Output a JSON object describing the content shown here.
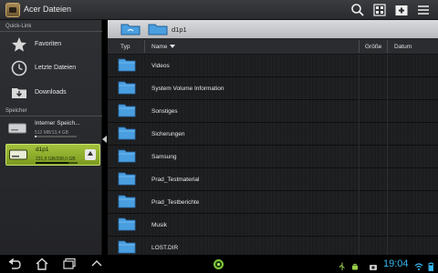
{
  "app": {
    "title": "Acer Dateien"
  },
  "toolbar": {
    "icons": [
      "search-icon",
      "grid-view-icon",
      "new-folder-icon",
      "menu-icon"
    ]
  },
  "sidebar": {
    "quick_link_label": "Quick-Link",
    "quick_links": [
      {
        "label": "Favoriten",
        "icon": "star-icon"
      },
      {
        "label": "Letzte Dateien",
        "icon": "clock-icon"
      },
      {
        "label": "Downloads",
        "icon": "downloads-folder-icon"
      }
    ],
    "storage_label": "Speicher",
    "storage": [
      {
        "name": "Interner Speich...",
        "size": "512 MB/13,4 GB",
        "used_fraction": 0.04,
        "active": false
      },
      {
        "name": "d1p1",
        "size": "231,5 GB/298,0 GB",
        "used_fraction": 0.78,
        "active": true
      }
    ]
  },
  "path": {
    "crumbs": [
      {
        "label": ""
      },
      {
        "label": "d1p1"
      }
    ]
  },
  "table": {
    "columns": {
      "type": "Typ",
      "name": "Name",
      "size": "Größe",
      "date": "Datum"
    },
    "sort": "name-descending",
    "rows": [
      {
        "name": "Videos"
      },
      {
        "name": "System Volume Information"
      },
      {
        "name": "Sonstiges"
      },
      {
        "name": "Sicherungen"
      },
      {
        "name": "Samsung"
      },
      {
        "name": "Prad_Testmaterial"
      },
      {
        "name": "Prad_Testberichte"
      },
      {
        "name": "Musik"
      },
      {
        "name": "LOST.DIR"
      }
    ]
  },
  "statusbar": {
    "time": "19:04"
  },
  "colors": {
    "accent_green": "#8cb22a",
    "clock_blue": "#37b7ee",
    "folder_blue": "#4a9fe0"
  }
}
